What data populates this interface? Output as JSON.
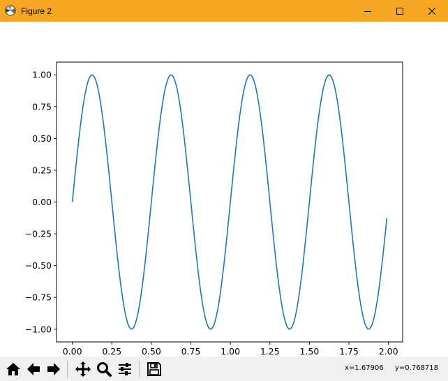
{
  "window": {
    "title": "Figure 2",
    "controls": [
      "minimize",
      "maximize",
      "close"
    ],
    "titlebar_color": "#f5a623"
  },
  "toolbar": {
    "buttons": [
      {
        "name": "home",
        "icon": "home-icon"
      },
      {
        "name": "back",
        "icon": "arrow-left-icon"
      },
      {
        "name": "forward",
        "icon": "arrow-right-icon"
      },
      {
        "name": "pan",
        "icon": "move-icon"
      },
      {
        "name": "zoom",
        "icon": "magnifier-icon"
      },
      {
        "name": "configure-subplots",
        "icon": "sliders-icon"
      },
      {
        "name": "save",
        "icon": "floppy-disk-icon"
      }
    ],
    "coord_x": "x=1.67906",
    "coord_y": "y=0.768718"
  },
  "chart_data": {
    "type": "line",
    "title": "",
    "xlabel": "",
    "ylabel": "",
    "xlim": [
      -0.1,
      2.09
    ],
    "ylim": [
      -1.1,
      1.1
    ],
    "xticks": [
      "0.00",
      "0.25",
      "0.50",
      "0.75",
      "1.00",
      "1.25",
      "1.50",
      "1.75",
      "2.00"
    ],
    "yticks": [
      "1.00",
      "0.75",
      "0.50",
      "0.25",
      "0.00",
      "−0.25",
      "−0.50",
      "−0.75",
      "−1.00"
    ],
    "grid": false,
    "series": [
      {
        "color": "#1f77b4",
        "x_start": 0.0,
        "x_end": 1.99,
        "x_step": 0.01,
        "function": "sin(4*pi*x)",
        "frequency_hz": 2,
        "amplitude": 1
      }
    ]
  }
}
